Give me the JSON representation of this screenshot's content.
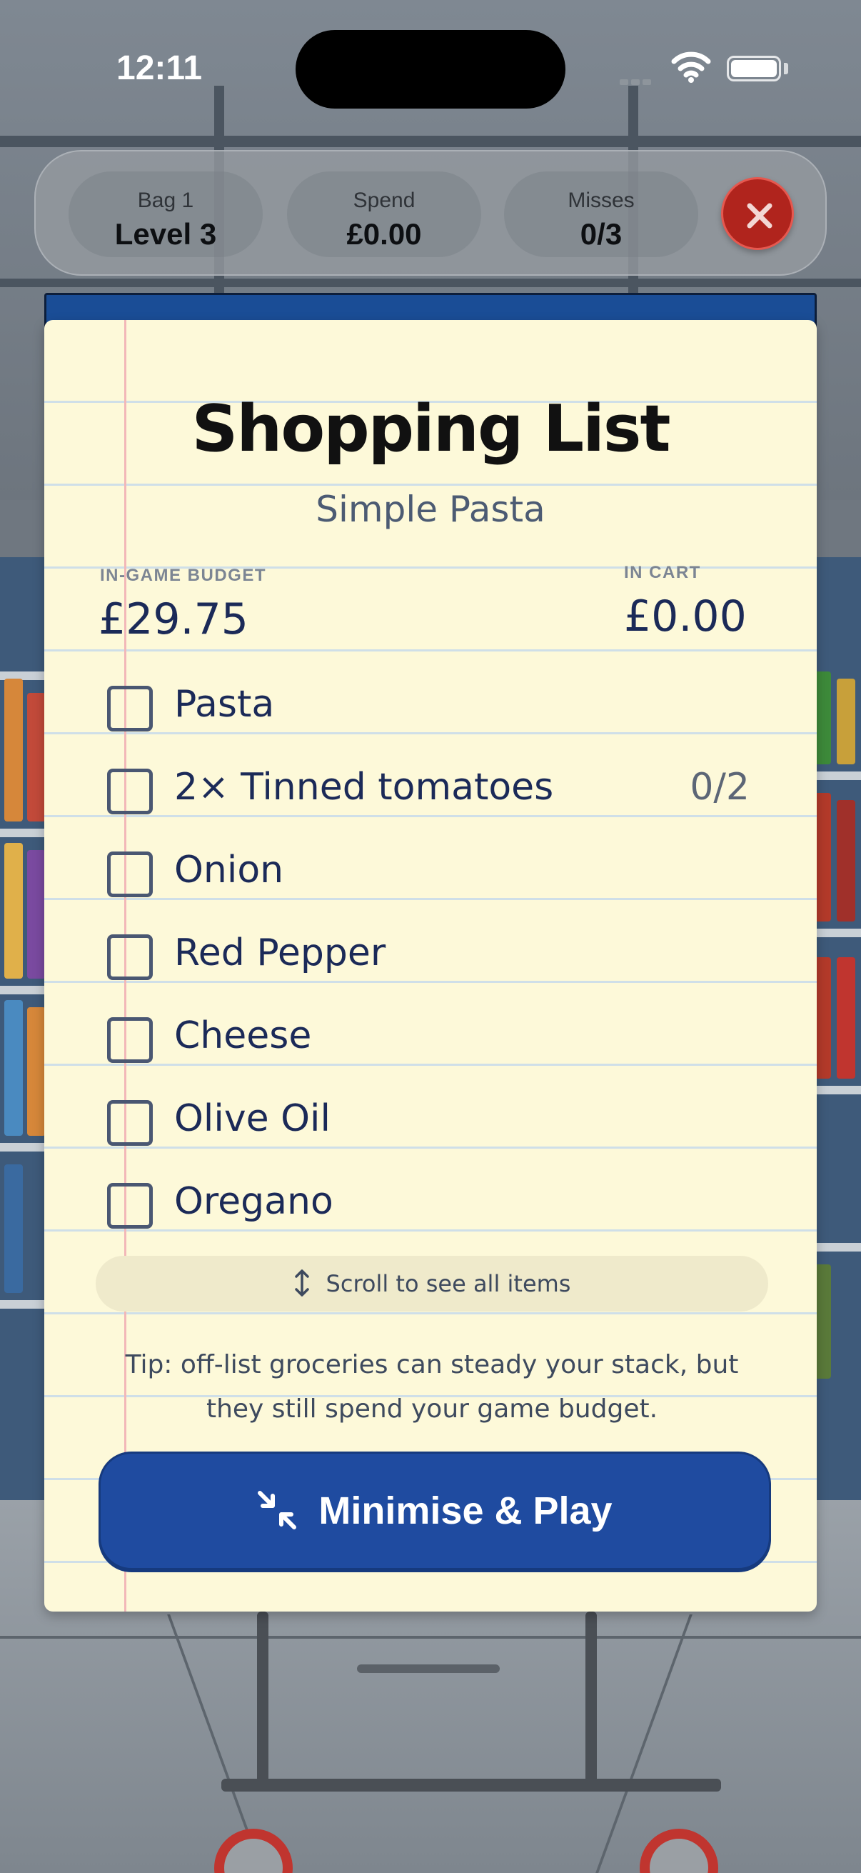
{
  "status_bar": {
    "time": "12:11"
  },
  "hud": {
    "bag": {
      "label": "Bag 1",
      "value": "Level 3"
    },
    "spend": {
      "label": "Spend",
      "value": "£0.00"
    },
    "misses": {
      "label": "Misses",
      "value": "0/3"
    },
    "close_icon": "close-icon"
  },
  "list": {
    "title": "Shopping List",
    "subtitle": "Simple Pasta",
    "budget": {
      "label": "IN-GAME BUDGET",
      "value": "£29.75"
    },
    "cart": {
      "label": "IN CART",
      "value": "£0.00"
    },
    "items": [
      {
        "label": "Pasta",
        "count": "",
        "checked": false
      },
      {
        "label": "2× Tinned tomatoes",
        "count": "0/2",
        "checked": false
      },
      {
        "label": "Onion",
        "count": "",
        "checked": false
      },
      {
        "label": "Red Pepper",
        "count": "",
        "checked": false
      },
      {
        "label": "Cheese",
        "count": "",
        "checked": false
      },
      {
        "label": "Olive Oil",
        "count": "",
        "checked": false
      },
      {
        "label": "Oregano",
        "count": "",
        "checked": false
      }
    ],
    "scroll_hint": "Scroll to see all items",
    "tip": "Tip: off-list groceries can steady your stack, but they still spend your game budget.",
    "play_button": "Minimise & Play"
  },
  "colors": {
    "accent_blue": "#1f4ba0",
    "close_red": "#b0241d",
    "paper": "#fdf9d9",
    "ink": "#1b2a58"
  }
}
